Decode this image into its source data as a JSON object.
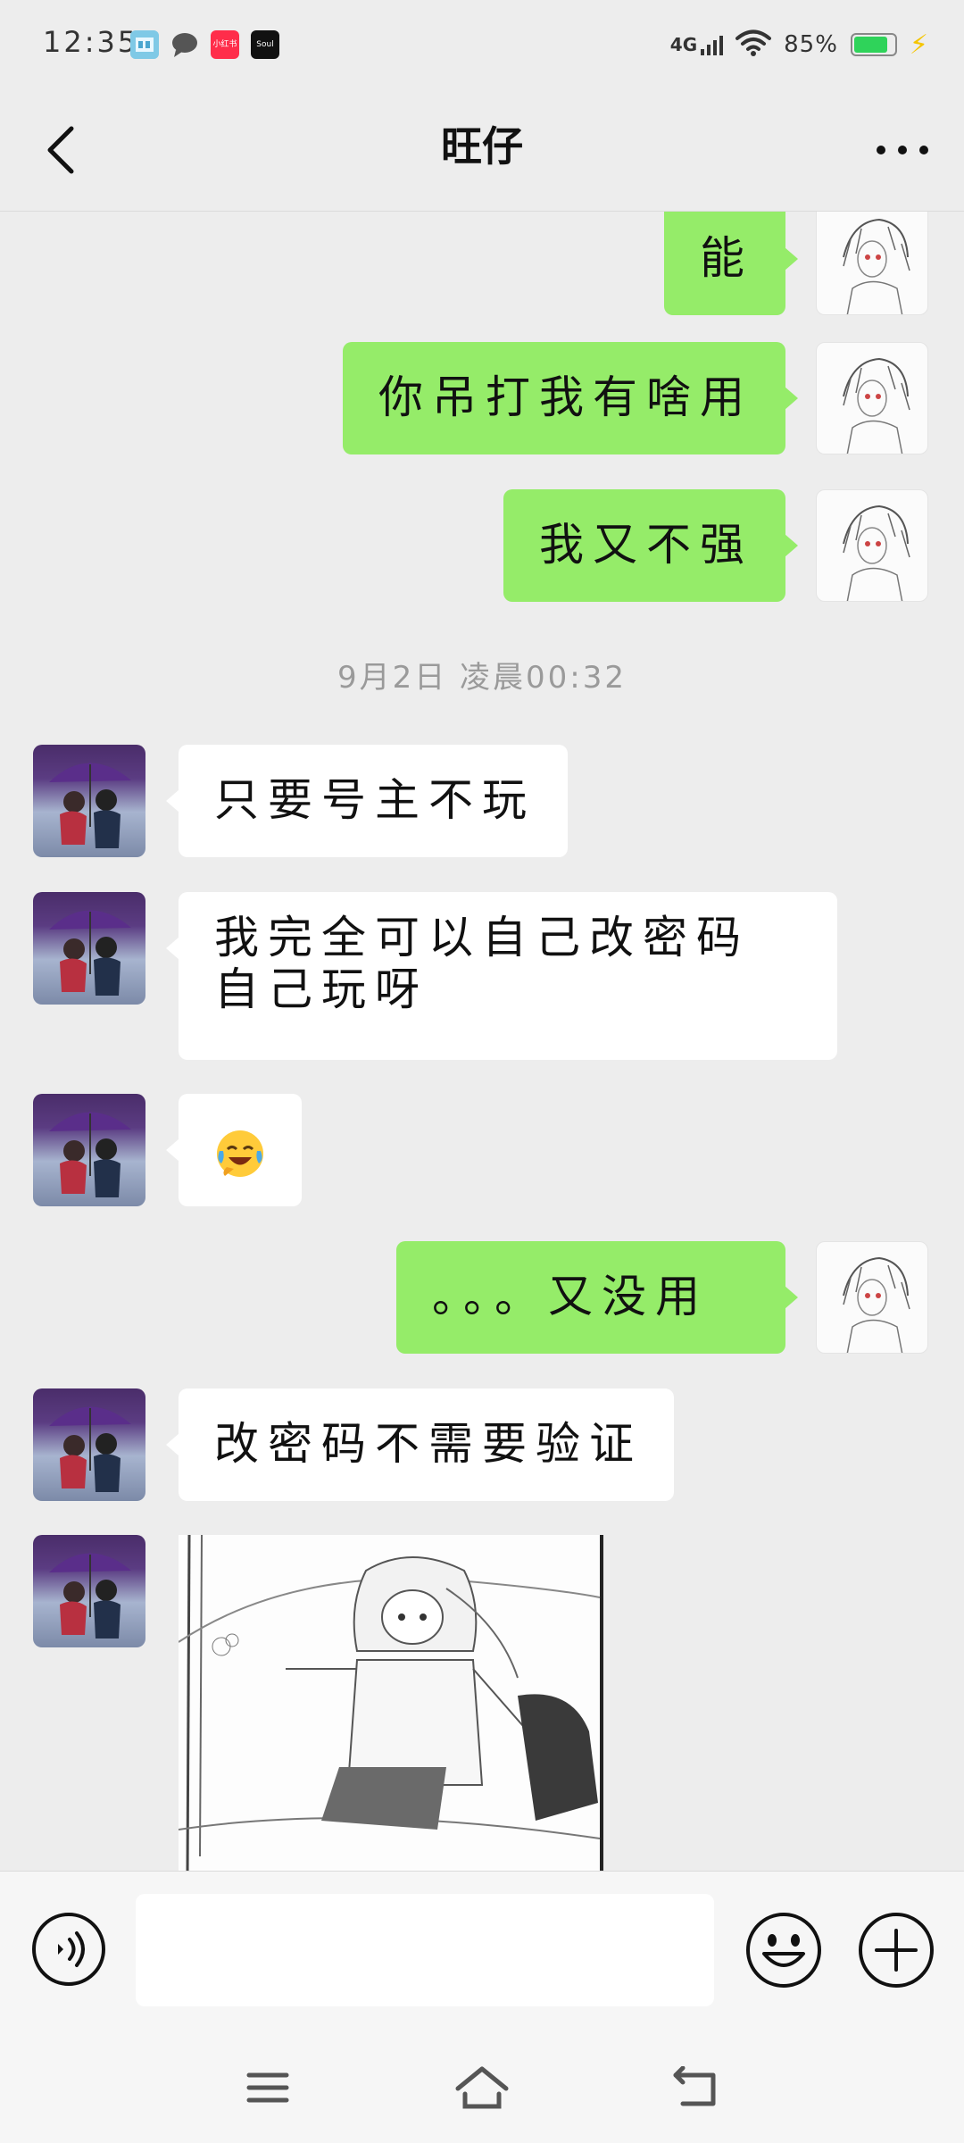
{
  "status_bar": {
    "time": "12:35",
    "network": "4G",
    "battery_percent": "85%",
    "battery_level": 0.85,
    "notification_apps": [
      {
        "name": "app-icon-1",
        "label": ""
      },
      {
        "name": "chat-bubble-icon",
        "label": ""
      },
      {
        "name": "xiaohongshu-icon",
        "label": "小红书"
      },
      {
        "name": "soul-icon",
        "label": "Soul"
      }
    ]
  },
  "header": {
    "title": "旺仔",
    "back_icon": "chevron-left-icon",
    "more_icon": "more-dots-icon"
  },
  "messages": [
    {
      "side": "out",
      "type": "text",
      "text": "能"
    },
    {
      "side": "out",
      "type": "text",
      "text": "你吊打我有啥用"
    },
    {
      "side": "out",
      "type": "text",
      "text": "我又不强"
    },
    {
      "type": "timestamp",
      "text": "9月2日 凌晨00:32"
    },
    {
      "side": "in",
      "type": "text",
      "text": "只要号主不玩"
    },
    {
      "side": "in",
      "type": "text",
      "text": "我完全可以自己改密码自己玩呀"
    },
    {
      "side": "in",
      "type": "emoji",
      "icon": "laughing-crying-emoji-icon"
    },
    {
      "side": "out",
      "type": "text",
      "text": "。。。又没用"
    },
    {
      "side": "in",
      "type": "text",
      "text": "改密码不需要验证"
    },
    {
      "side": "in",
      "type": "image",
      "icon": "anime-sticker-image"
    }
  ],
  "input_bar": {
    "value": "",
    "placeholder": "",
    "voice_icon": "voice-icon",
    "emoji_icon": "emoji-icon",
    "plus_icon": "plus-icon"
  },
  "nav_bar": {
    "menu_icon": "menu-icon",
    "home_icon": "home-icon",
    "back_icon": "back-nav-icon"
  },
  "colors": {
    "background": "#ededed",
    "outgoing_bubble": "#95ec69",
    "incoming_bubble": "#ffffff",
    "battery": "#2fd35a"
  }
}
